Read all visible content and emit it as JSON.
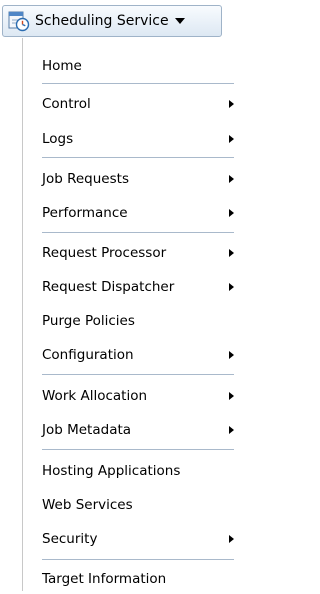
{
  "menu_button": {
    "label": "Scheduling Service",
    "icon": "scheduling-service-icon"
  },
  "menu": {
    "items": [
      {
        "label": "Home",
        "has_submenu": false
      },
      {
        "label": "Control",
        "has_submenu": true
      },
      {
        "label": "Logs",
        "has_submenu": true
      },
      {
        "label": "Job Requests",
        "has_submenu": true
      },
      {
        "label": "Performance",
        "has_submenu": true
      },
      {
        "label": "Request Processor",
        "has_submenu": true
      },
      {
        "label": "Request Dispatcher",
        "has_submenu": true
      },
      {
        "label": "Purge Policies",
        "has_submenu": false
      },
      {
        "label": "Configuration",
        "has_submenu": true
      },
      {
        "label": "Work Allocation",
        "has_submenu": true
      },
      {
        "label": "Job Metadata",
        "has_submenu": true
      },
      {
        "label": "Hosting Applications",
        "has_submenu": false
      },
      {
        "label": "Web Services",
        "has_submenu": false
      },
      {
        "label": "Security",
        "has_submenu": true
      },
      {
        "label": "Target Information",
        "has_submenu": false
      }
    ]
  },
  "colors": {
    "separator": "#a9b9cb",
    "button_border": "#9fb3c8"
  }
}
